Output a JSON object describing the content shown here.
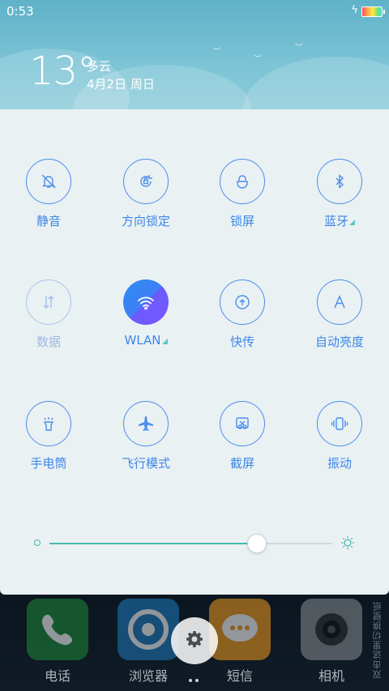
{
  "status_bar": {
    "time": "0:53"
  },
  "weather": {
    "temperature": "13°",
    "condition": "多云",
    "date": "4月2日 周日"
  },
  "tiles": [
    {
      "label": "静音",
      "icon": "silent-bell-icon",
      "state": "off",
      "expand": false
    },
    {
      "label": "方向锁定",
      "icon": "rotation-lock-icon",
      "state": "off",
      "expand": false
    },
    {
      "label": "锁屏",
      "icon": "lock-icon",
      "state": "off",
      "expand": false
    },
    {
      "label": "蓝牙",
      "icon": "bluetooth-icon",
      "state": "off",
      "expand": true
    },
    {
      "label": "数据",
      "icon": "data-icon",
      "state": "disabled",
      "expand": false
    },
    {
      "label": "WLAN",
      "icon": "wifi-icon",
      "state": "on",
      "expand": true
    },
    {
      "label": "快传",
      "icon": "quick-transfer-icon",
      "state": "off",
      "expand": false
    },
    {
      "label": "自动亮度",
      "icon": "auto-brightness-icon",
      "state": "off",
      "expand": false
    },
    {
      "label": "手电筒",
      "icon": "flashlight-icon",
      "state": "off",
      "expand": false
    },
    {
      "label": "飞行模式",
      "icon": "airplane-icon",
      "state": "off",
      "expand": false
    },
    {
      "label": "截屏",
      "icon": "screenshot-icon",
      "state": "off",
      "expand": false
    },
    {
      "label": "振动",
      "icon": "vibrate-icon",
      "state": "off",
      "expand": false
    }
  ],
  "brightness": {
    "level": 0.73
  },
  "dock": [
    {
      "label": "电话",
      "icon": "phone-icon",
      "color": "#1f8a3a"
    },
    {
      "label": "浏览器",
      "icon": "browser-icon",
      "color": "#1e7bbf"
    },
    {
      "label": "短信",
      "icon": "message-icon",
      "color": "#f39a1d"
    },
    {
      "label": "相机",
      "icon": "camera-icon",
      "color": "#8a8f93"
    }
  ],
  "side_hint": "双击这里切换壁纸",
  "colors": {
    "accent": "#3d86e6",
    "panel": "#eaf1f3",
    "slider": "#49b9b0"
  }
}
